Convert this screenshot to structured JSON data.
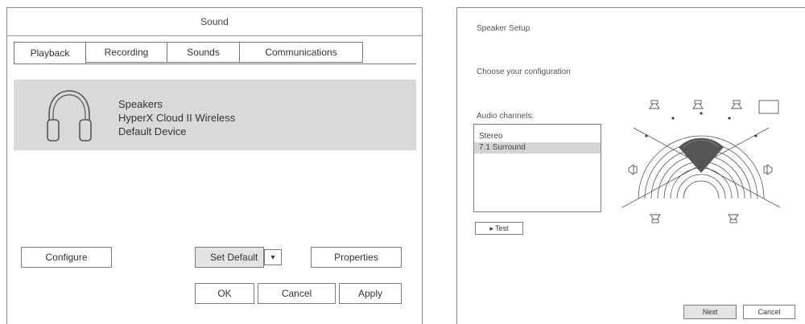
{
  "sound": {
    "title": "Sound",
    "tabs": [
      {
        "label": "Playback"
      },
      {
        "label": "Recording"
      },
      {
        "label": "Sounds"
      },
      {
        "label": "Communications"
      }
    ],
    "device": {
      "name": "Speakers",
      "model": "HyperX Cloud II Wireless",
      "status": "Default Device",
      "icon": "headphones-icon"
    },
    "buttons": {
      "configure": "Configure",
      "set_default": "Set Default",
      "dropdown_arrow": "▾",
      "properties": "Properties",
      "ok": "OK",
      "cancel": "Cancel",
      "apply": "Apply"
    }
  },
  "speaker_setup": {
    "title": "Speaker Setup",
    "prompt": "Choose your configuration",
    "channels_label": "Audio channels:",
    "channels": [
      {
        "label": "Stereo",
        "selected": false
      },
      {
        "label": "7.1 Surround",
        "selected": true
      }
    ],
    "test_label": "▸ Test",
    "next_label": "Next",
    "cancel_label": "Cancel"
  }
}
